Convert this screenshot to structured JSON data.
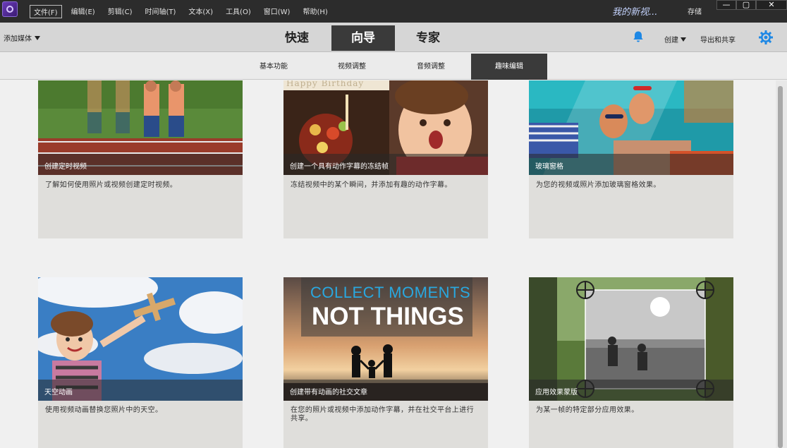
{
  "menu": {
    "items": [
      "文件(F)",
      "编辑(E)",
      "剪辑(C)",
      "时间轴(T)",
      "文本(X)",
      "工具(O)",
      "窗口(W)",
      "帮助(H)"
    ],
    "active_index": 0
  },
  "title_bar": {
    "project_title": "我的新视...",
    "save_label": "存储",
    "min_glyph": "—",
    "max_glyph": "▢",
    "close_glyph": "✕"
  },
  "toolbar": {
    "add_media_label": "添加媒体",
    "modes": [
      "快速",
      "向导",
      "专家"
    ],
    "active_mode_index": 1,
    "create_label": "创建",
    "export_label": "导出和共享"
  },
  "sub_tabs": {
    "items": [
      "基本功能",
      "视频调整",
      "音频调整",
      "趣味编辑"
    ],
    "active_index": 3
  },
  "cards": [
    {
      "caption": "创建定时视频",
      "description": "了解如何使用照片或视频创建定时视频。"
    },
    {
      "caption": "创建一个具有动作字幕的冻结帧",
      "description": "冻结视频中的某个瞬间，并添加有趣的动作字幕。",
      "image_text": "Happy Birthday"
    },
    {
      "caption": "玻璃窗格",
      "description": "为您的视频或照片添加玻璃窗格效果。"
    },
    {
      "caption": "天空动画",
      "description": "使用视频动画替换您照片中的天空。"
    },
    {
      "caption": "创建带有动画的社交文章",
      "description": "在您的照片或视频中添加动作字幕，并在社交平台上进行共享。",
      "image_text_top": "COLLECT MOMENTS",
      "image_text_bottom": "NOT THINGS"
    },
    {
      "caption": "应用效果蒙版",
      "description": "为某一帧的特定部分应用效果。"
    }
  ],
  "colors": {
    "titlebar_bg": "#2c2c2c",
    "active_tab_bg": "#3a3a3a",
    "accent_blue": "#1e88e5",
    "card_bg": "#dfdedb"
  },
  "icons": {
    "app": "premiere-elements-icon",
    "notification": "bell-icon",
    "settings": "gear-icon"
  }
}
